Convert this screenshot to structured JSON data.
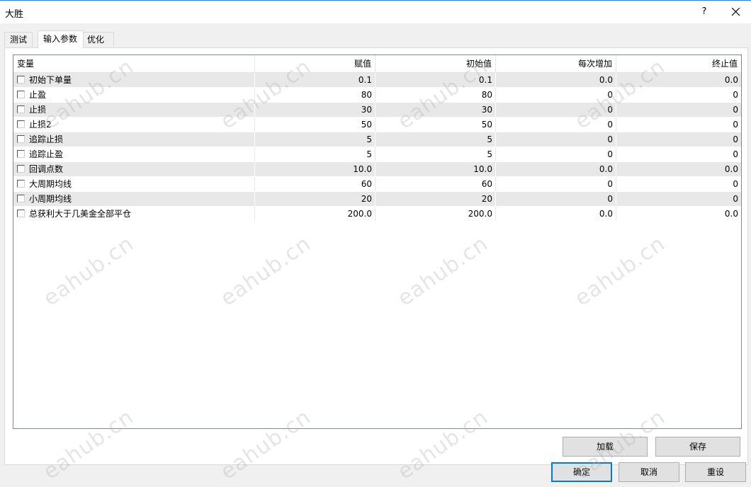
{
  "window": {
    "title": "大胜",
    "help_label": "?"
  },
  "tabs": [
    {
      "label": "测试",
      "active": false
    },
    {
      "label": "输入参数",
      "active": true
    },
    {
      "label": "优化",
      "active": false
    }
  ],
  "table": {
    "columns": [
      "变量",
      "赋值",
      "初始值",
      "每次增加",
      "终止值"
    ],
    "rows": [
      {
        "name": "初始下单量",
        "value": "0.1",
        "start": "0.1",
        "step": "0.0",
        "stop": "0.0",
        "checked": false
      },
      {
        "name": "止盈",
        "value": "80",
        "start": "80",
        "step": "0",
        "stop": "0",
        "checked": false
      },
      {
        "name": "止损",
        "value": "30",
        "start": "30",
        "step": "0",
        "stop": "0",
        "checked": false
      },
      {
        "name": "止损2",
        "value": "50",
        "start": "50",
        "step": "0",
        "stop": "0",
        "checked": false
      },
      {
        "name": "追踪止损",
        "value": "5",
        "start": "5",
        "step": "0",
        "stop": "0",
        "checked": false
      },
      {
        "name": "追踪止盈",
        "value": "5",
        "start": "5",
        "step": "0",
        "stop": "0",
        "checked": false
      },
      {
        "name": "回调点数",
        "value": "10.0",
        "start": "10.0",
        "step": "0.0",
        "stop": "0.0",
        "checked": false
      },
      {
        "name": "大周期均线",
        "value": "60",
        "start": "60",
        "step": "0",
        "stop": "0",
        "checked": false
      },
      {
        "name": "小周期均线",
        "value": "20",
        "start": "20",
        "step": "0",
        "stop": "0",
        "checked": false
      },
      {
        "name": "总获利大于几美金全部平仓",
        "value": "200.0",
        "start": "200.0",
        "step": "0.0",
        "stop": "0.0",
        "checked": false
      }
    ]
  },
  "buttons": {
    "load": "加载",
    "save": "保存",
    "ok": "确定",
    "cancel": "取消",
    "reset": "重设"
  },
  "watermark": "eahub.cn",
  "colors": {
    "accent": "#0078d7",
    "row_alt": "#e8e8e8",
    "title_border": "#2b79d8"
  }
}
